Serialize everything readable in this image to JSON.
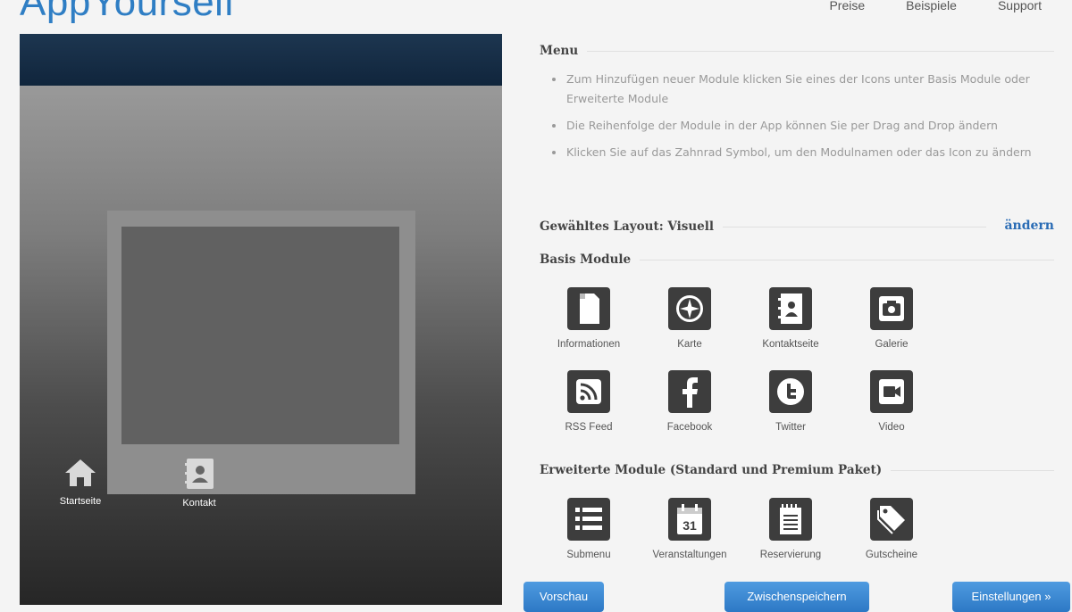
{
  "brand": {
    "logo_text": "AppYourself",
    "accent_color": "#2f7ec4"
  },
  "topnav": {
    "items": [
      "Preise",
      "Beispiele",
      "Support"
    ]
  },
  "preview": {
    "modules": [
      {
        "label": "Startseite",
        "icon": "home-icon"
      },
      {
        "label": "Kontakt",
        "icon": "contact-icon"
      }
    ]
  },
  "menu": {
    "heading": "Menu",
    "instructions": [
      "Zum Hinzufügen neuer Module klicken Sie eines der Icons unter Basis Module oder Erweiterte Module",
      "Die Reihenfolge der Module in der App können Sie per Drag and Drop ändern",
      "Klicken Sie auf das Zahnrad Symbol, um den Modulnamen oder das Icon zu ändern"
    ]
  },
  "layout": {
    "heading": "Gewähltes Layout: Visuell",
    "change_label": "ändern"
  },
  "basis": {
    "heading": "Basis Module",
    "modules": [
      {
        "label": "Informationen",
        "icon": "document-icon"
      },
      {
        "label": "Karte",
        "icon": "compass-icon"
      },
      {
        "label": "Kontaktseite",
        "icon": "address-book-icon"
      },
      {
        "label": "Galerie",
        "icon": "camera-icon"
      },
      {
        "label": "RSS Feed",
        "icon": "rss-icon"
      },
      {
        "label": "Facebook",
        "icon": "facebook-icon"
      },
      {
        "label": "Twitter",
        "icon": "twitter-icon"
      },
      {
        "label": "Video",
        "icon": "video-camera-icon"
      }
    ]
  },
  "extended": {
    "heading": "Erweiterte Module (Standard und Premium Paket)",
    "modules": [
      {
        "label": "Submenu",
        "icon": "list-icon"
      },
      {
        "label": "Veranstaltungen",
        "icon": "calendar-icon",
        "day": "31"
      },
      {
        "label": "Reservierung",
        "icon": "notepad-icon"
      },
      {
        "label": "Gutscheine",
        "icon": "tag-icon"
      }
    ]
  },
  "buttons": {
    "preview": "Vorschau",
    "save": "Zwischenspeichern",
    "settings": "Einstellungen »"
  }
}
